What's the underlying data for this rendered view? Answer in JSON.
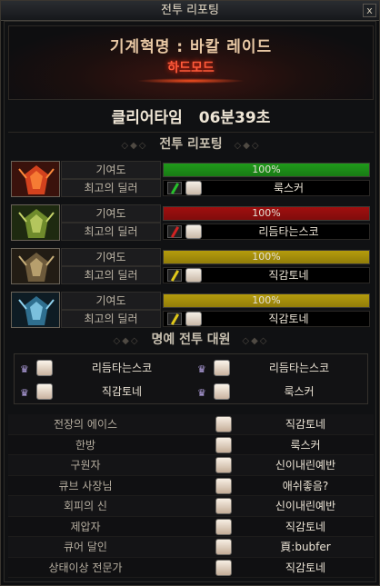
{
  "window": {
    "title": "전투 리포팅",
    "close_label": "x"
  },
  "header": {
    "dungeon": "기계혁명 : 바칼 레이드",
    "mode": "하드모드"
  },
  "clear": {
    "label": "클리어타임",
    "time": "06분39초"
  },
  "report_title": "전투 리포팅",
  "deco": "◇◆◇",
  "reports": [
    {
      "boss_icon": "fire-boss-icon",
      "contribution_label": "기여도",
      "contribution": 1.0,
      "contribution_text": "100%",
      "bar_color": "#1f9a1a",
      "dealer_label": "최고의 딜러",
      "weapon_color": "#27c02b",
      "dealer": "룩스커"
    },
    {
      "boss_icon": "wind-boss-icon",
      "contribution_label": "기여도",
      "contribution": 1.0,
      "contribution_text": "100%",
      "bar_color": "#a00f0f",
      "dealer_label": "최고의 딜러",
      "weapon_color": "#d22222",
      "dealer": "리듬타는스코"
    },
    {
      "boss_icon": "earth-boss-icon",
      "contribution_label": "기여도",
      "contribution": 1.0,
      "contribution_text": "100%",
      "bar_color": "#b59c0c",
      "dealer_label": "최고의 딜러",
      "weapon_color": "#e0c81a",
      "dealer": "직감토네"
    },
    {
      "boss_icon": "ice-boss-icon",
      "contribution_label": "기여도",
      "contribution": 1.0,
      "contribution_text": "100%",
      "bar_color": "#b59c0c",
      "dealer_label": "최고의 딜러",
      "weapon_color": "#e0c81a",
      "dealer": "직감토네"
    }
  ],
  "honor_title": "명예 전투 대원",
  "honor": [
    "리듬타는스코",
    "리듬타는스코",
    "직감토네",
    "룩스커"
  ],
  "awards": [
    {
      "title": "전장의 에이스",
      "name": "직감토네"
    },
    {
      "title": "한방",
      "name": "룩스커"
    },
    {
      "title": "구원자",
      "name": "신이내린예반"
    },
    {
      "title": "큐브 사장님",
      "name": "애쉬좋음?"
    },
    {
      "title": "회피의 신",
      "name": "신이내린예반"
    },
    {
      "title": "제압자",
      "name": "직감토네"
    },
    {
      "title": "큐어 달인",
      "name": "頁:bubfer"
    },
    {
      "title": "상태이상 전문가",
      "name": "직감토네"
    }
  ]
}
